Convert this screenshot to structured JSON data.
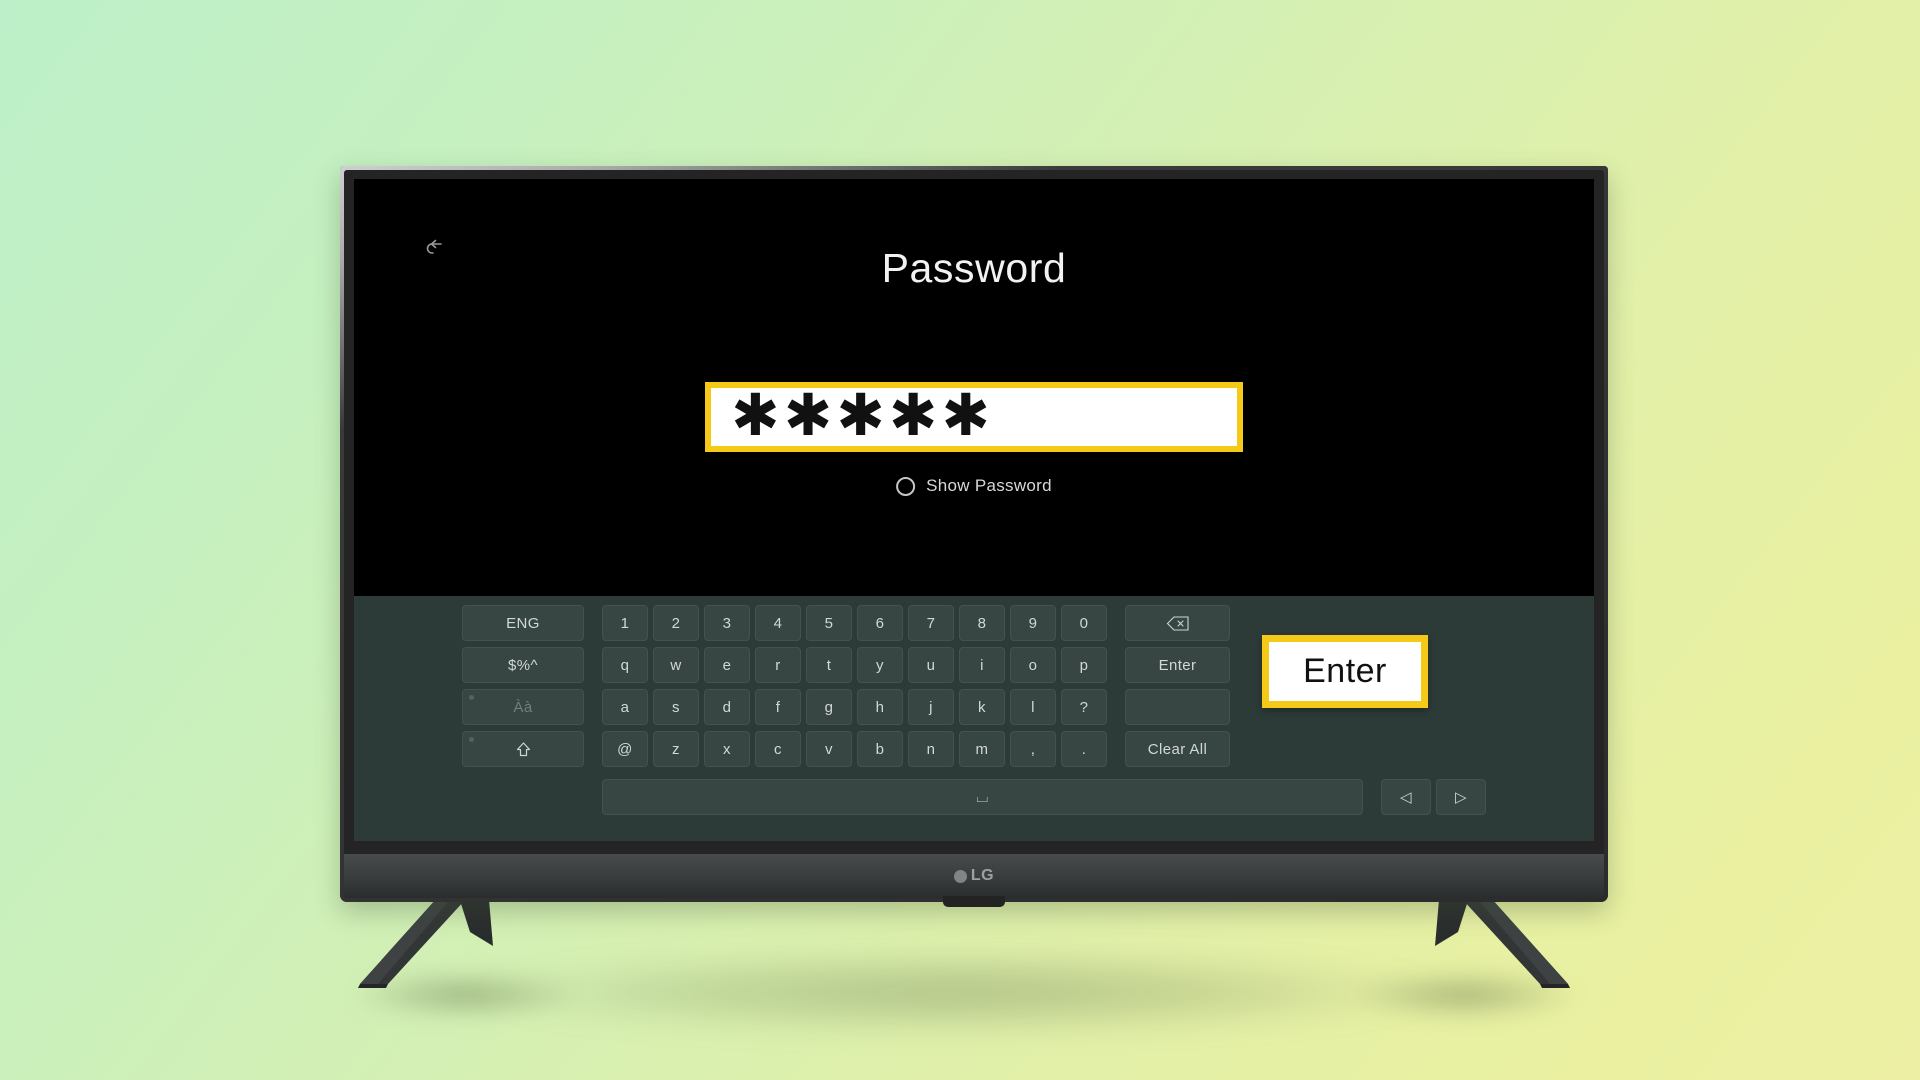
{
  "background": {
    "gradient_from": "#bdf0c9",
    "gradient_to": "#edf0a4"
  },
  "device": {
    "brand": "LG",
    "type": "television"
  },
  "screen": {
    "back_icon": "back-arrow-icon",
    "title": "Password",
    "password_field": {
      "value": "✱✱✱✱✱",
      "masked_char_count": 5,
      "highlight_color": "#f5c918"
    },
    "show_password": {
      "label": "Show Password",
      "checked": false
    }
  },
  "keyboard": {
    "function_keys": [
      {
        "label": "ENG",
        "name": "language-key",
        "dimmed": false,
        "dot": false
      },
      {
        "label": "$%^",
        "name": "symbols-key",
        "dimmed": false,
        "dot": false
      },
      {
        "label": "Àà",
        "name": "accents-key",
        "dimmed": true,
        "dot": true
      },
      {
        "label": "⇧",
        "name": "shift-key",
        "dimmed": false,
        "dot": true
      }
    ],
    "rows": [
      [
        "1",
        "2",
        "3",
        "4",
        "5",
        "6",
        "7",
        "8",
        "9",
        "0"
      ],
      [
        "q",
        "w",
        "e",
        "r",
        "t",
        "y",
        "u",
        "i",
        "o",
        "p"
      ],
      [
        "a",
        "s",
        "d",
        "f",
        "g",
        "h",
        "j",
        "k",
        "l",
        "?"
      ],
      [
        "@",
        "z",
        "x",
        "c",
        "v",
        "b",
        "n",
        "m",
        ",",
        "."
      ]
    ],
    "right_keys": [
      {
        "label": "⌫",
        "name": "backspace-key"
      },
      {
        "label": "Enter",
        "name": "enter-key"
      },
      {
        "label": "",
        "name": "enter-key-spacer"
      },
      {
        "label": "Clear All",
        "name": "clear-all-key"
      }
    ],
    "space_key": {
      "label": "⌴",
      "name": "space-key"
    },
    "nav_keys": [
      {
        "label": "◁",
        "name": "cursor-left-key"
      },
      {
        "label": "▷",
        "name": "cursor-right-key"
      }
    ]
  },
  "callout": {
    "enter_label": "Enter",
    "border_color": "#f5c918"
  }
}
